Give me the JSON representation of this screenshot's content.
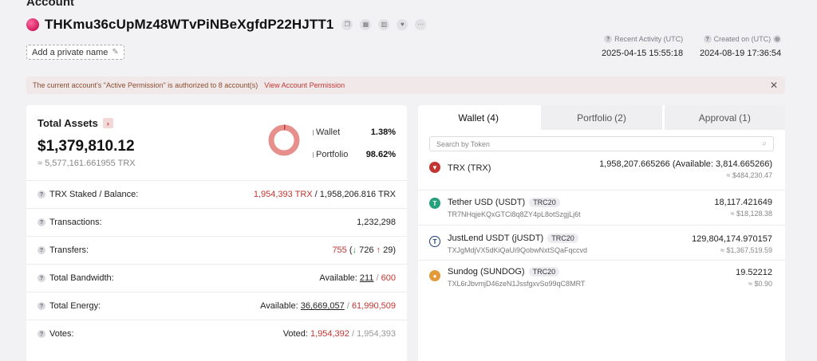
{
  "page_heading": "Account",
  "account": {
    "address": "THKmu36cUpMz48WTvPiNBeXgfdP22HJTT1",
    "private_name_label": "Add a private name",
    "icons": [
      "copy-icon",
      "qr-code-icon",
      "chart-icon",
      "heart-icon",
      "more-icon"
    ]
  },
  "meta": {
    "recent_activity_label": "Recent Activity (UTC)",
    "recent_activity_value": "2025-04-15 15:55:18",
    "created_on_label": "Created on (UTC)",
    "created_on_value": "2024-08-19 17:36:54"
  },
  "notice": {
    "text": "The current account's \"Active Permission\" is authorized to 8 account(s)",
    "link": "View Account Permission",
    "close": "✕"
  },
  "assets": {
    "title": "Total Assets",
    "value": "$1,379,810.12",
    "trx_value": "≈ 5,577,161.661955 TRX",
    "legend": [
      {
        "name": "Wallet",
        "value": "1.38%"
      },
      {
        "name": "Portfolio",
        "value": "98.62%"
      }
    ],
    "donut_fractions": {
      "wallet": 0.0138,
      "portfolio": 0.9862
    },
    "colors": {
      "wallet": "#c23631",
      "portfolio": "#e68f8c"
    }
  },
  "stats": {
    "staked": {
      "label": "TRX Staked / Balance:",
      "staked": "1,954,393 TRX",
      "sep": " / ",
      "balance": "1,958,206.816 TRX"
    },
    "transactions": {
      "label": "Transactions:",
      "value": "1,232,298"
    },
    "transfers": {
      "label": "Transfers:",
      "total": "755",
      "open": " (",
      "in_arrow": "↓",
      "in": "726",
      "out_arrow": "↑",
      "out": "29",
      "close": ")"
    },
    "bandwidth": {
      "label": "Total Bandwidth:",
      "prefix": "Available: ",
      "available": "211",
      "sep": " / ",
      "total": "600"
    },
    "energy": {
      "label": "Total Energy:",
      "prefix": "Available: ",
      "available": "36,669,057",
      "sep": " / ",
      "total": "61,990,509"
    },
    "votes": {
      "label": "Votes:",
      "prefix": "Voted: ",
      "voted": "1,954,392",
      "sep": " / ",
      "total": "1,954,393"
    }
  },
  "tabs": [
    {
      "label": "Wallet",
      "count": "(4)"
    },
    {
      "label": "Portfolio",
      "count": "(2)"
    },
    {
      "label": "Approval",
      "count": "(1)"
    }
  ],
  "search": {
    "placeholder": "Search by Token"
  },
  "tokens": [
    {
      "name": "TRX (TRX)",
      "badge": "",
      "address": "",
      "balance": "1,958,207.665266 (Available: 3,814.665266)",
      "usd": "≈ $484,230.47",
      "icon": "trx-icon",
      "color": "#c23631"
    },
    {
      "name": "Tether USD (USDT)",
      "badge": "TRC20",
      "address": "TR7NHqjeKQxGTCi8q8ZY4pL8otSzgjLj6t",
      "balance": "18,117.421649",
      "usd": "≈ $18,128.38",
      "icon": "usdt-icon",
      "color": "#26a17b"
    },
    {
      "name": "JustLend USDT (jUSDT)",
      "badge": "TRC20",
      "address": "TXJgMdjVX5dKiQaUi9QobwNxtSQaFqccvd",
      "balance": "129,804,174.970157",
      "usd": "≈ $1,367,519.59",
      "icon": "jusdt-icon",
      "color": "#1f3f7a"
    },
    {
      "name": "Sundog (SUNDOG)",
      "badge": "TRC20",
      "address": "TXL6rJbvmjD46zeN1JssfgxvSo99qC8MRT",
      "balance": "19.52212",
      "usd": "≈ $0.90",
      "icon": "sundog-icon",
      "color": "#e39a3b"
    }
  ]
}
